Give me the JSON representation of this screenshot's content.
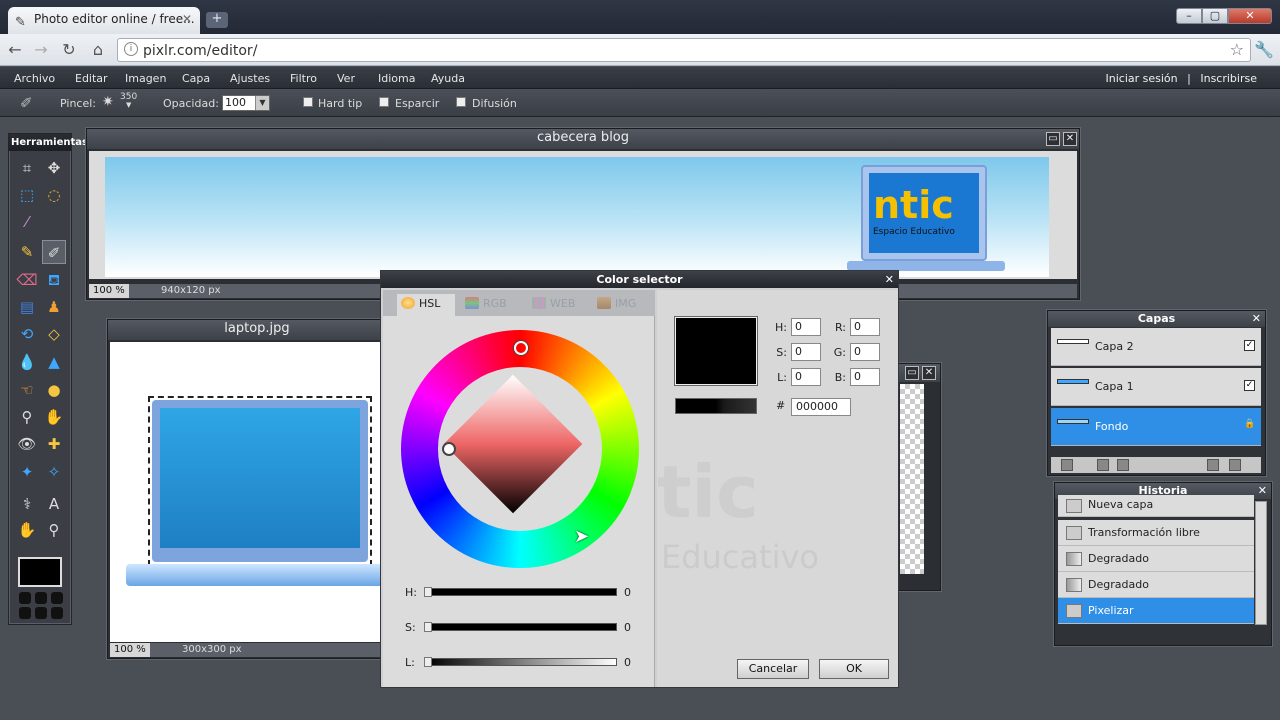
{
  "browser": {
    "tab_title": "Photo editor online / free...",
    "tab_close": "✕",
    "new_tab": "+",
    "url": "pixlr.com/editor/",
    "window_buttons": [
      "–",
      "▢",
      "✕"
    ]
  },
  "menu": {
    "items": [
      "Archivo",
      "Editar",
      "Imagen",
      "Capa",
      "Ajustes",
      "Filtro",
      "Ver",
      "Idioma",
      "Ayuda"
    ],
    "login": "Iniciar sesión",
    "separator": "|",
    "register": "Inscribirse"
  },
  "options": {
    "brush_label": "Pincel:",
    "brush_size": "350",
    "opacity_label": "Opacidad:",
    "opacity_value": "100",
    "hard_tip": "Hard tip",
    "scatter": "Esparcir",
    "diffusion": "Difusión"
  },
  "tools": {
    "title": "Herramientas",
    "icons": [
      "crop-icon",
      "move-icon",
      "marquee-icon",
      "lasso-icon",
      "wand-icon",
      "pencil-icon",
      "brush-icon",
      "eraser-icon",
      "bucket-icon",
      "gradient-icon",
      "clone-icon",
      "color-replace-icon",
      "drawing-icon",
      "shape-icon",
      "blur-icon",
      "sharpen-icon",
      "smudge-icon",
      "sponge-icon",
      "dodge-icon",
      "burn-icon",
      "redeye-icon",
      "spot-heal-icon",
      "bloat-icon",
      "pinch-icon",
      "picker-icon",
      "text-icon",
      "hand-icon",
      "zoom-icon"
    ]
  },
  "windows": {
    "blog": {
      "title": "cabecera blog",
      "zoom": "100 %",
      "size": "940x120 px"
    },
    "laptop": {
      "title": "laptop.jpg",
      "zoom": "100 %",
      "size": "300x300 px"
    }
  },
  "logo": {
    "text": "ntic",
    "sub": "Espacio Educativo"
  },
  "color_selector": {
    "title": "Color selector",
    "close": "✕",
    "tabs": [
      "HSL",
      "RGB",
      "WEB",
      "IMG"
    ],
    "active_tab": "HSL",
    "sliders": [
      {
        "label": "H:",
        "value": "0"
      },
      {
        "label": "S:",
        "value": "0"
      },
      {
        "label": "L:",
        "value": "0"
      }
    ],
    "fields": {
      "h_label": "H:",
      "h": "0",
      "s_label": "S:",
      "s": "0",
      "l_label": "L:",
      "l": "0",
      "r_label": "R:",
      "r": "0",
      "g_label": "G:",
      "g": "0",
      "b_label": "B:",
      "b": "0"
    },
    "hash": "#",
    "hex": "000000",
    "selected_color": "#000000",
    "watermark": "tic",
    "watermark2": "Educativo",
    "cancel": "Cancelar",
    "ok": "OK"
  },
  "layers": {
    "title": "Capas",
    "items": [
      {
        "name": "Capa 2",
        "check": "✓"
      },
      {
        "name": "Capa 1",
        "check": "✓"
      },
      {
        "name": "Fondo",
        "check": "🔒"
      }
    ]
  },
  "history": {
    "title": "Historia",
    "items": [
      "Nueva capa",
      "Transformación libre",
      "Degradado",
      "Degradado",
      "Pixelizar"
    ]
  }
}
